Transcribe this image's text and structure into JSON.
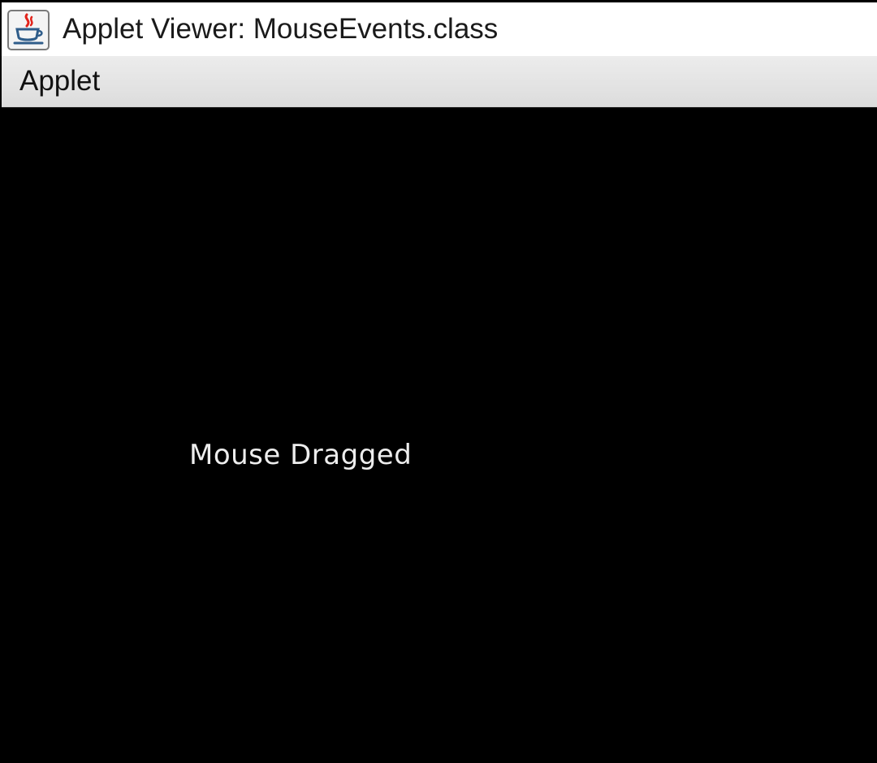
{
  "window": {
    "title": "Applet Viewer: MouseEvents.class",
    "icon": "java-coffee-cup-icon"
  },
  "menubar": {
    "items": [
      {
        "label": "Applet"
      }
    ]
  },
  "applet": {
    "background_color": "#000000",
    "text_color": "#ededed",
    "message": "Mouse Dragged"
  }
}
